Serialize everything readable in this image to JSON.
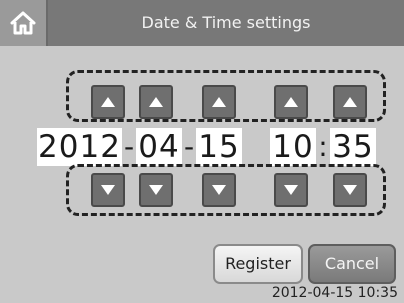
{
  "header": {
    "title": "Date & Time settings",
    "home_icon": "home-icon"
  },
  "datetime": {
    "year": "2012",
    "month": "04",
    "day": "15",
    "hour": "10",
    "minute": "35",
    "date_separator": "-",
    "time_separator": ":"
  },
  "controls": {
    "increment_icon": "triangle-up-icon",
    "decrement_icon": "triangle-down-icon"
  },
  "buttons": {
    "register_label": "Register",
    "cancel_label": "Cancel"
  },
  "status": {
    "current_datetime": "2012-04-15 10:35"
  },
  "colors": {
    "background": "#c9c9c9",
    "header": "#787878",
    "arrow_button": "#6f6f6f"
  }
}
